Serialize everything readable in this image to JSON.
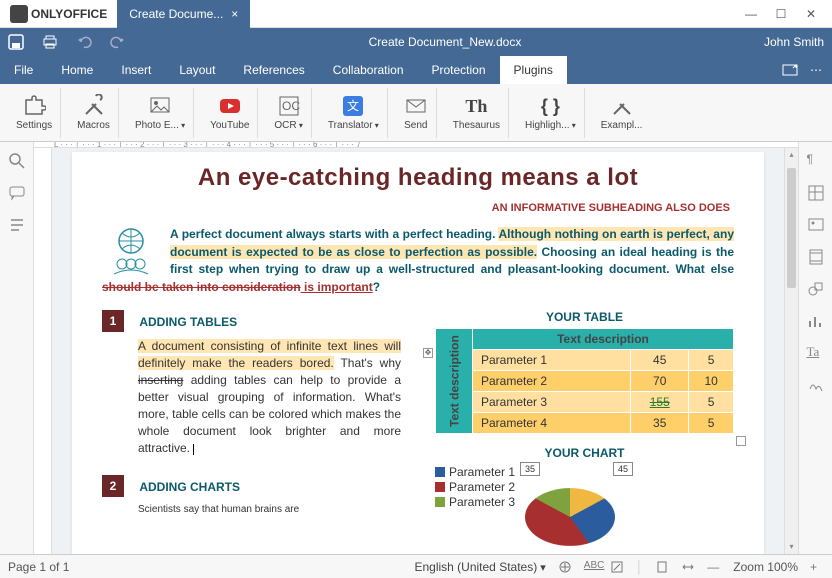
{
  "app_name": "ONLYOFFICE",
  "tab_title": "Create Docume...",
  "doc_title": "Create Document_New.docx",
  "user_name": "John Smith",
  "menu": [
    "File",
    "Home",
    "Insert",
    "Layout",
    "References",
    "Collaboration",
    "Protection",
    "Plugins"
  ],
  "active_menu": 7,
  "ribbon": [
    {
      "label": "Settings",
      "icon": "puzzle"
    },
    {
      "label": "Macros",
      "icon": "braces"
    },
    {
      "label": "Photo E...",
      "icon": "image",
      "dd": true
    },
    {
      "label": "YouTube",
      "icon": "play"
    },
    {
      "label": "OCR",
      "icon": "ocr",
      "dd": true
    },
    {
      "label": "Translator",
      "icon": "translate",
      "dd": true
    },
    {
      "label": "Send",
      "icon": "envelope"
    },
    {
      "label": "Thesaurus",
      "icon": "th"
    },
    {
      "label": "Highligh...",
      "icon": "highlight",
      "dd": true
    },
    {
      "label": "Exampl...",
      "icon": "tools"
    }
  ],
  "document": {
    "heading": "An eye-catching heading means a lot",
    "subheading": "AN INFORMATIVE SUBHEADING ALSO DOES",
    "lead_plain1": "A perfect document always starts with a perfect heading. ",
    "lead_hl": "Although nothing on earth is perfect, any document is expected to be as close to perfection as possible.",
    "lead_plain2": " Choosing an ideal heading is the first step when trying to draw up a well-structured and pleasant-looking document. What else ",
    "lead_strike": "should be taken into consideration",
    "lead_ins": " is important",
    "lead_plain3": "?",
    "sections": [
      {
        "num": "1",
        "title": "ADDING TABLES",
        "body_hl": "A document consisting of infinite text lines will definitely make the readers bored.",
        "body_plain1": " That's why ",
        "body_strike": "inserting",
        "body_plain2": " adding tables can help to provide a better visual grouping of information. What's more, table cells can be colored which makes the whole document look brighter and more attractive. "
      },
      {
        "num": "2",
        "title": "ADDING CHARTS",
        "body": "Scientists say that human brains are"
      }
    ],
    "table_title": "YOUR TABLE",
    "table_header": "Text description",
    "table_side": "Text description",
    "table_rows": [
      {
        "p": "Parameter 1",
        "v1": "45",
        "v2": "5"
      },
      {
        "p": "Parameter 2",
        "v1": "70",
        "v2": "10"
      },
      {
        "p": "Parameter 3",
        "v1": "155",
        "v2": "5",
        "strike": true
      },
      {
        "p": "Parameter 4",
        "v1": "35",
        "v2": "5"
      }
    ],
    "chart_title": "YOUR CHART",
    "chart_legend": [
      "Parameter 1",
      "Parameter 2",
      "Parameter 3"
    ],
    "callout1": "35",
    "callout2": "45"
  },
  "status": {
    "page": "Page 1 of 1",
    "lang": "English (United States)",
    "zoom": "Zoom 100%"
  },
  "ruler_h": "L  · · · │ · · · 1 · · · │ · · · 2 · · · │ · · · 3 · · · │ · · · 4 · · · │ · · · 5 · · · │ · · · 6 · · · │ · · · 7",
  "chart_data": {
    "type": "pie",
    "categories": [
      "Parameter 1",
      "Parameter 2",
      "Parameter 3",
      "Parameter 4"
    ],
    "values": [
      45,
      70,
      35,
      5
    ],
    "title": "YOUR CHART",
    "callouts": {
      "Parameter 1": 45,
      "Parameter 4": 35
    },
    "colors": {
      "Parameter 1": "#2b5d9e",
      "Parameter 2": "#a82f2f",
      "Parameter 3": "#7ea23d",
      "Parameter 4": "#f0b840"
    }
  }
}
